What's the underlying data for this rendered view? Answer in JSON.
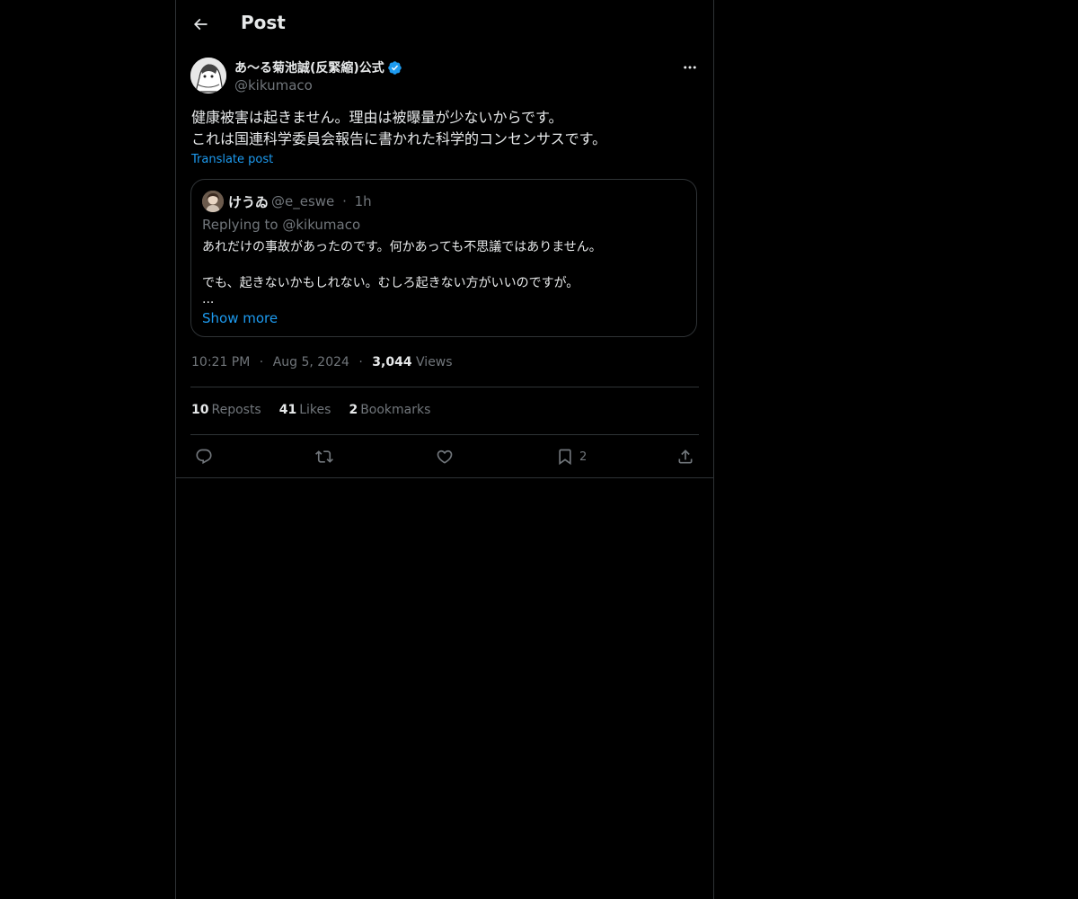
{
  "header": {
    "title": "Post"
  },
  "post": {
    "author_name": "あ〜る菊池誠(反緊縮)公式",
    "author_handle": "@kikumaco",
    "text_lines": [
      "健康被害は起きません。理由は被曝量が少ないからです。",
      "これは国連科学委員会報告に書かれた科学的コンセンサスです。"
    ],
    "translate_label": "Translate post",
    "time": "10:21 PM",
    "date": "Aug 5, 2024",
    "views_count": "3,044",
    "views_label": "Views",
    "separator": "·"
  },
  "quote": {
    "name": "けうゐ",
    "handle": "@e_eswe",
    "age": "1h",
    "separator": "·",
    "replying": "Replying to @kikumaco",
    "lines": [
      "あれだけの事故があったのです。何かあっても不思議ではありません。",
      "でも、起きないかもしれない。むしろ起きない方がいいのですが。",
      "..."
    ],
    "show_more": "Show more"
  },
  "stats": {
    "reposts_count": "10",
    "reposts_label": "Reposts",
    "likes_count": "41",
    "likes_label": "Likes",
    "bookmarks_count": "2",
    "bookmarks_label": "Bookmarks"
  },
  "actions": {
    "bookmark_count": "2"
  },
  "colors": {
    "background": "#000000",
    "text": "#e7e9ea",
    "muted": "#71767b",
    "accent": "#1d9bf0",
    "border": "#2f3336"
  },
  "icons": {
    "back": "arrow-left-icon",
    "verified": "verified-badge-icon",
    "more": "more-horizontal-icon",
    "reply": "reply-icon",
    "repost": "repost-icon",
    "like": "heart-icon",
    "bookmark": "bookmark-icon",
    "share": "share-icon"
  }
}
